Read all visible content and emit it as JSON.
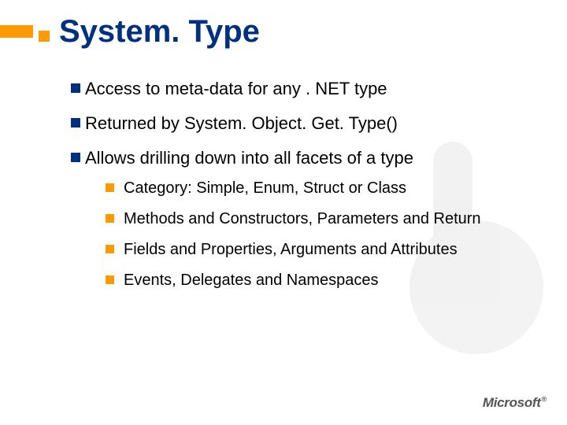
{
  "title": "System. Type",
  "bullets": [
    {
      "text": "Access to meta-data for any . NET type"
    },
    {
      "text": "Returned by System. Object. Get. Type()"
    },
    {
      "text": "Allows drilling down into all facets of a type",
      "children": [
        "Category: Simple, Enum, Struct or Class",
        "Methods and Constructors, Parameters and Return",
        "Fields and Properties, Arguments and Attributes",
        "Events, Delegates and Namespaces"
      ]
    }
  ],
  "logo": {
    "text": "Microsoft",
    "reg": "®"
  }
}
